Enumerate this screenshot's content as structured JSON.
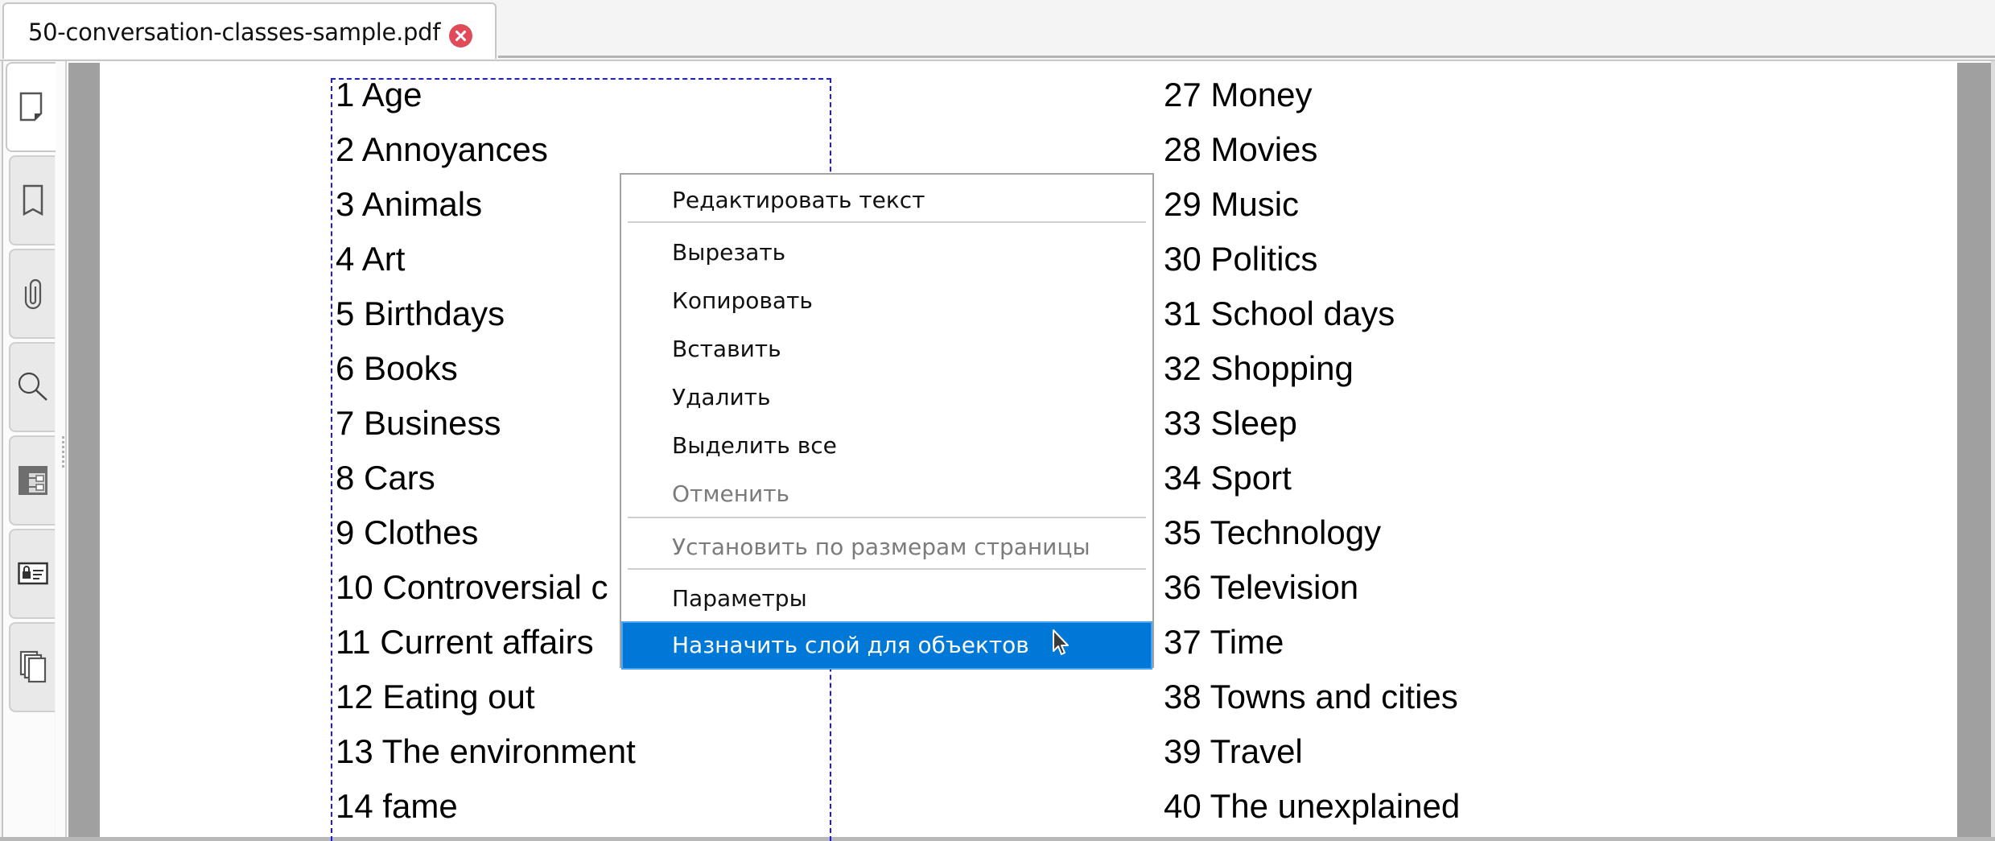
{
  "tab": {
    "title": "50-conversation-classes-sample.pdf",
    "close_icon": "close-circle-icon",
    "close_color": "#e04b5a"
  },
  "sidebar": {
    "tabs": [
      {
        "name": "pages",
        "icon": "page-icon",
        "active": true
      },
      {
        "name": "bookmarks",
        "icon": "bookmark-icon",
        "active": false
      },
      {
        "name": "attachments",
        "icon": "paperclip-icon",
        "active": false
      },
      {
        "name": "search",
        "icon": "search-icon",
        "active": false
      },
      {
        "name": "layers",
        "icon": "layers-tree-icon",
        "active": false
      },
      {
        "name": "signatures",
        "icon": "id-card-lock-icon",
        "active": false
      },
      {
        "name": "pages-stack",
        "icon": "stacked-pages-icon",
        "active": false
      }
    ]
  },
  "document": {
    "left_column": [
      "1 Age",
      "2 Annoyances",
      "3 Animals",
      "4 Art",
      "5 Birthdays",
      "6 Books",
      "7 Business",
      "8 Cars",
      "9 Clothes",
      "10 Controversial c",
      "11 Current affairs",
      "12 Eating out",
      "13 The environment",
      "14 fame"
    ],
    "right_column": [
      "27 Money",
      "28 Movies",
      "29 Music",
      "30 Politics",
      "31 School days",
      "32 Shopping",
      "33 Sleep",
      "34 Sport",
      "35 Technology",
      "36 Television",
      "37 Time",
      "38 Towns and cities",
      "39 Travel",
      "40 The unexplained"
    ]
  },
  "context_menu": {
    "items": [
      {
        "label": "Редактировать текст",
        "enabled": true
      },
      {
        "label": "Вырезать",
        "enabled": true
      },
      {
        "label": "Копировать",
        "enabled": true
      },
      {
        "label": "Вставить",
        "enabled": true
      },
      {
        "label": "Удалить",
        "enabled": true
      },
      {
        "label": "Выделить все",
        "enabled": true
      },
      {
        "label": "Отменить",
        "enabled": false
      },
      {
        "label": "Установить по размерам страницы",
        "enabled": false
      },
      {
        "label": "Параметры",
        "enabled": true
      },
      {
        "label": "Назначить слой для объектов",
        "enabled": true,
        "highlighted": true
      }
    ],
    "highlight_color": "#0078d7"
  },
  "colors": {
    "selection_border": "#1a1aef",
    "gutter": "#a0a0a0"
  }
}
